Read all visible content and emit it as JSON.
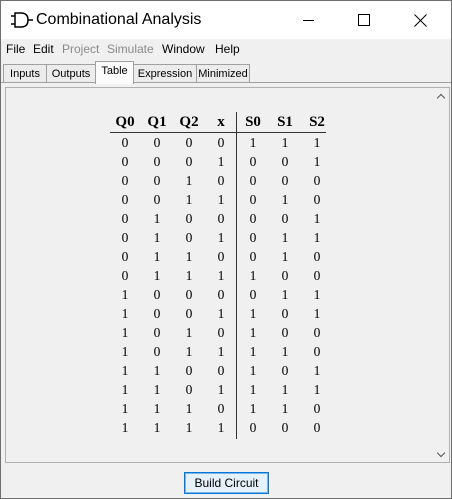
{
  "window": {
    "title": "Combinational Analysis",
    "icons": {
      "app": "logic-gate-icon",
      "minimize": "minimize-icon",
      "maximize": "maximize-icon",
      "close": "close-icon"
    }
  },
  "menu": [
    "File",
    "Edit",
    "Project",
    "Simulate",
    "Window",
    "Help"
  ],
  "menu_disabled": [
    "Project",
    "Simulate"
  ],
  "tabs": [
    "Inputs",
    "Outputs",
    "Table",
    "Expression",
    "Minimized"
  ],
  "active_tab": "Table",
  "truth_table": {
    "input_headers": [
      "Q0",
      "Q1",
      "Q2",
      "x"
    ],
    "output_headers": [
      "S0",
      "S1",
      "S2"
    ],
    "rows": [
      [
        "0",
        "0",
        "0",
        "0",
        "1",
        "1",
        "1"
      ],
      [
        "0",
        "0",
        "0",
        "1",
        "0",
        "0",
        "1"
      ],
      [
        "0",
        "0",
        "1",
        "0",
        "0",
        "0",
        "0"
      ],
      [
        "0",
        "0",
        "1",
        "1",
        "0",
        "1",
        "0"
      ],
      [
        "0",
        "1",
        "0",
        "0",
        "0",
        "0",
        "1"
      ],
      [
        "0",
        "1",
        "0",
        "1",
        "0",
        "1",
        "1"
      ],
      [
        "0",
        "1",
        "1",
        "0",
        "0",
        "1",
        "0"
      ],
      [
        "0",
        "1",
        "1",
        "1",
        "1",
        "0",
        "0"
      ],
      [
        "1",
        "0",
        "0",
        "0",
        "0",
        "1",
        "1"
      ],
      [
        "1",
        "0",
        "0",
        "1",
        "1",
        "0",
        "1"
      ],
      [
        "1",
        "0",
        "1",
        "0",
        "1",
        "0",
        "0"
      ],
      [
        "1",
        "0",
        "1",
        "1",
        "1",
        "1",
        "0"
      ],
      [
        "1",
        "1",
        "0",
        "0",
        "1",
        "0",
        "1"
      ],
      [
        "1",
        "1",
        "0",
        "1",
        "1",
        "1",
        "1"
      ],
      [
        "1",
        "1",
        "1",
        "0",
        "1",
        "1",
        "0"
      ],
      [
        "1",
        "1",
        "1",
        "1",
        "0",
        "0",
        "0"
      ]
    ]
  },
  "buttons": {
    "build_circuit": "Build Circuit"
  }
}
